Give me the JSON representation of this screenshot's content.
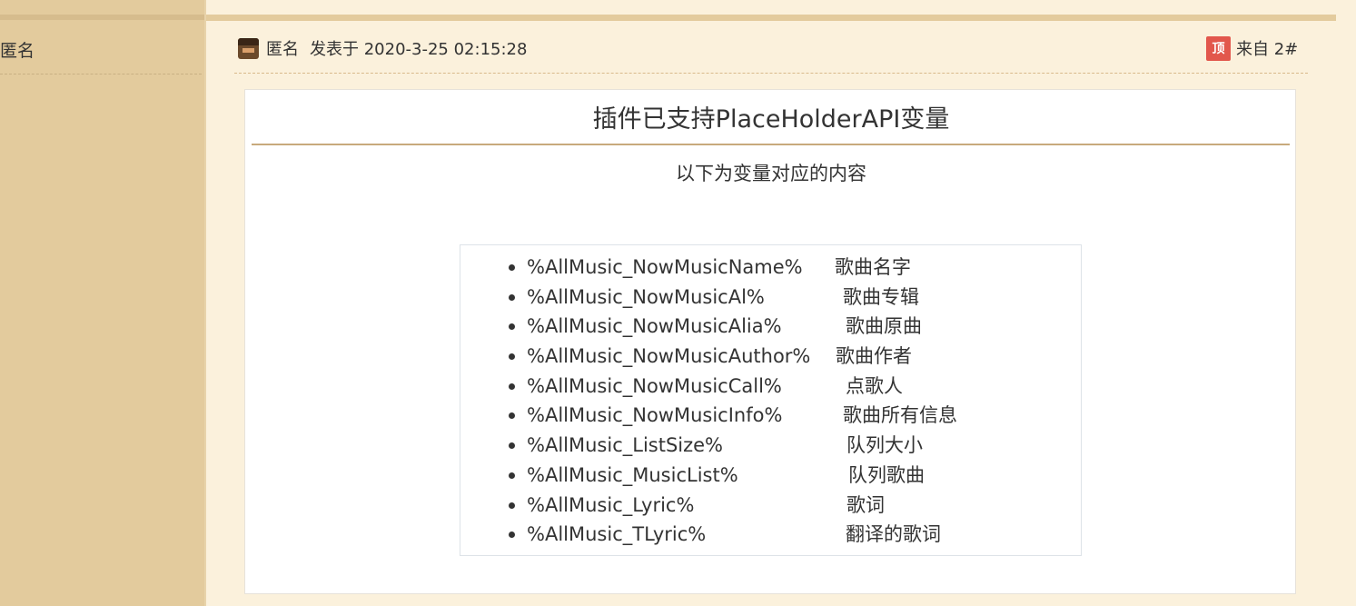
{
  "sidebar": {
    "author_name": "匿名"
  },
  "post": {
    "author": "匿名",
    "posted_at": "发表于 2020-3-25 02:15:28",
    "top_badge": "顶",
    "floor": "来自 2#"
  },
  "content": {
    "title": "插件已支持PlaceHolderAPI变量",
    "subtitle": "以下为变量对应的内容",
    "variables": [
      {
        "name": "%AllMusic_NowMusicName%",
        "desc": "歌曲名字"
      },
      {
        "name": "%AllMusic_NowMusicAl%",
        "desc": "歌曲专辑"
      },
      {
        "name": "%AllMusic_NowMusicAlia%",
        "desc": "歌曲原曲"
      },
      {
        "name": "%AllMusic_NowMusicAuthor%",
        "desc": "歌曲作者"
      },
      {
        "name": "%AllMusic_NowMusicCall%",
        "desc": "点歌人"
      },
      {
        "name": "%AllMusic_NowMusicInfo%",
        "desc": "歌曲所有信息"
      },
      {
        "name": "%AllMusic_ListSize%",
        "desc": "队列大小"
      },
      {
        "name": "%AllMusic_MusicList%",
        "desc": "队列歌曲"
      },
      {
        "name": "%AllMusic_Lyric%",
        "desc": "歌词"
      },
      {
        "name": "%AllMusic_TLyric%",
        "desc": "翻译的歌词"
      }
    ]
  }
}
